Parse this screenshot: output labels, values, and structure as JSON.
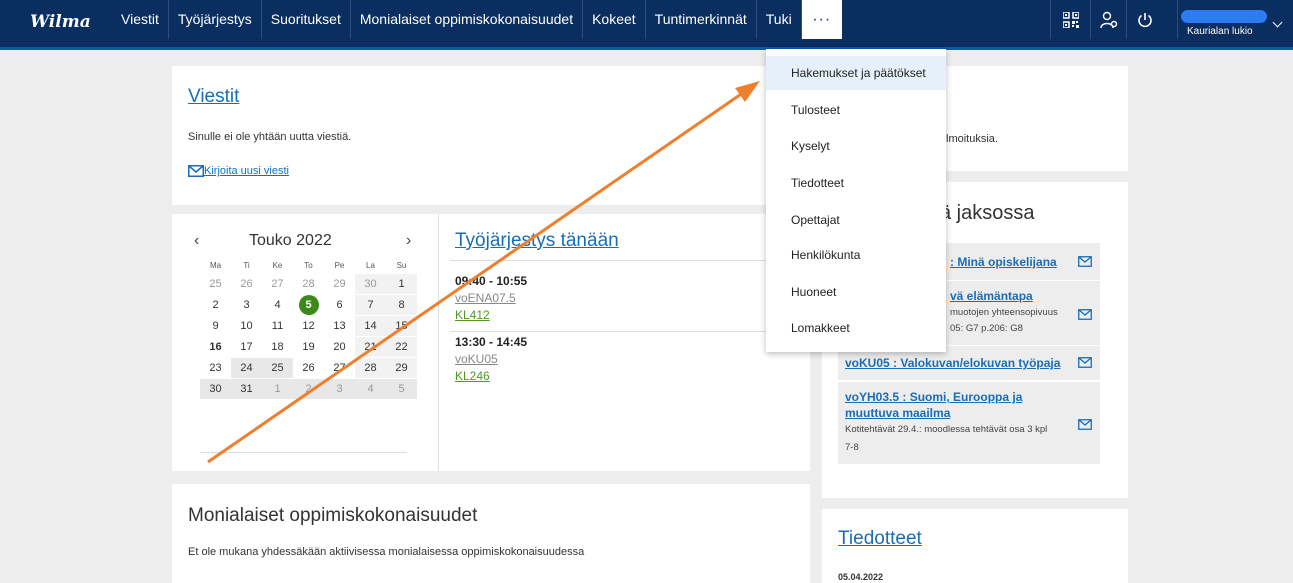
{
  "nav": {
    "logo": "Wilma",
    "items": [
      "Viestit",
      "Työjärjestys",
      "Suoritukset",
      "Monialaiset oppimiskokonaisuudet",
      "Kokeet",
      "Tuntimerkinnät",
      "Tuki"
    ],
    "more": "···",
    "school": "Kaurialan lukio"
  },
  "viestit": {
    "title": "Viestit",
    "empty": "Sinulle ei ole yhtään uutta viestiä.",
    "new_message": "Kirjoita uusi viesti"
  },
  "notices_peek": "lmoituksia.",
  "calendar": {
    "prev": "‹",
    "next": "›",
    "month": "Touko 2022",
    "day_headers": [
      "Ma",
      "Ti",
      "Ke",
      "To",
      "Pe",
      "La",
      "Su"
    ],
    "weeks": [
      [
        "25",
        "26",
        "27",
        "28",
        "29",
        "30",
        "1"
      ],
      [
        "2",
        "3",
        "4",
        "5",
        "6",
        "7",
        "8"
      ],
      [
        "9",
        "10",
        "11",
        "12",
        "13",
        "14",
        "15"
      ],
      [
        "16",
        "17",
        "18",
        "19",
        "20",
        "21",
        "22"
      ],
      [
        "23",
        "24",
        "25",
        "26",
        "27",
        "28",
        "29"
      ],
      [
        "30",
        "31",
        "1",
        "2",
        "3",
        "4",
        "5"
      ]
    ]
  },
  "schedule": {
    "title": "Työjärjestys tänään",
    "lessons": [
      {
        "time": "09:40 - 10:55",
        "course": "voENA07.5",
        "room": "KL412"
      },
      {
        "time": "13:30 - 14:45",
        "course": "voKU05",
        "room": "KL246"
      }
    ]
  },
  "courses_panel": {
    "title_visible": "sä jaksossa",
    "courses": [
      {
        "title": ": Minä opiskelijana",
        "sub": ""
      },
      {
        "title": "vä elämäntapa",
        "sub": "muotojen yhteensopivuus",
        "sub2": "05: G7 p.206: G8"
      },
      {
        "title": "voKU05 : Valokuvan/elokuvan työpaja",
        "sub": ""
      },
      {
        "title": "voYH03.5 : Suomi, Eurooppa ja",
        "title2": "muuttuva maailma",
        "sub": "Kotitehtävät 29.4.: moodlessa tehtävät osa 3 kpl",
        "sub2": "7-8"
      }
    ]
  },
  "monialaiset": {
    "title": "Monialaiset oppimiskokonaisuudet",
    "text": "Et ole mukana yhdessäkään aktiivisessa monialaisessa oppimiskokonaisuudessa"
  },
  "tiedotteet": {
    "title": "Tiedotteet",
    "date": "05.04.2022"
  },
  "dropdown": {
    "items": [
      "Hakemukset ja päätökset",
      "Tulosteet",
      "Kyselyt",
      "Tiedotteet",
      "Opettajat",
      "Henkilökunta",
      "Huoneet",
      "Lomakkeet"
    ],
    "highlighted": "Hakemukset ja päätökset"
  },
  "colors": {
    "nav_bg": "#092e5f",
    "link": "#1a6db5",
    "today": "#3c8a1a",
    "annotation_arrow": "#ee7f2d"
  }
}
